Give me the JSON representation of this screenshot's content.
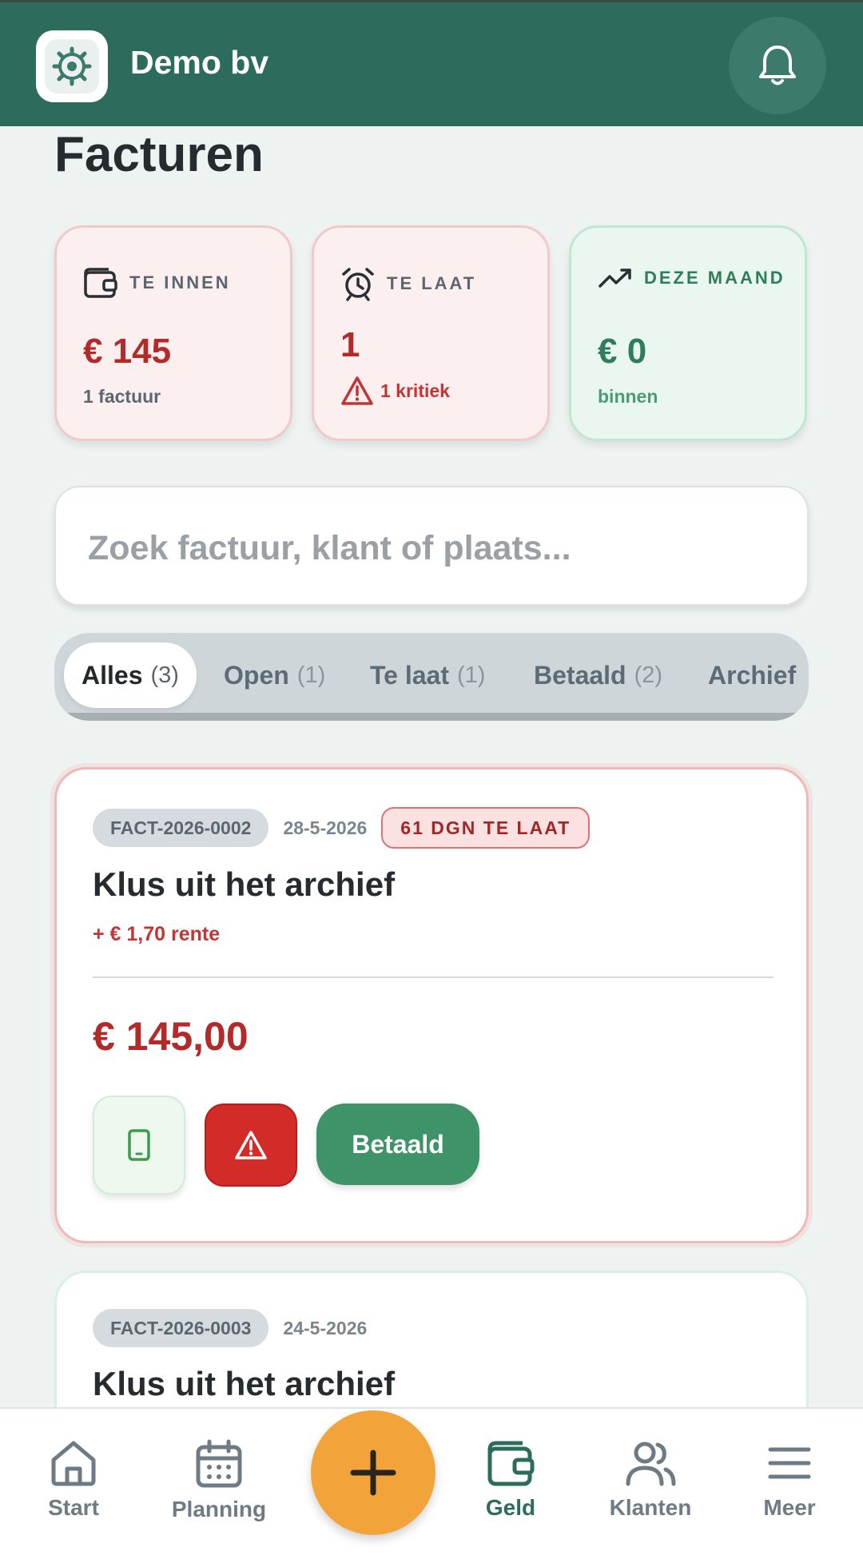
{
  "header": {
    "company": "Demo bv"
  },
  "page": {
    "title": "Facturen"
  },
  "stats": [
    {
      "label": "TE INNEN",
      "value": "€ 145",
      "sub": "1 factuur"
    },
    {
      "label": "TE LAAT",
      "value": "1",
      "sub": "1 kritiek"
    },
    {
      "label": "DEZE MAAND",
      "value": "€ 0",
      "sub": "binnen"
    }
  ],
  "search": {
    "placeholder": "Zoek factuur, klant of plaats..."
  },
  "tabs": [
    {
      "label": "Alles",
      "count": "(3)"
    },
    {
      "label": "Open",
      "count": "(1)"
    },
    {
      "label": "Te laat",
      "count": "(1)"
    },
    {
      "label": "Betaald",
      "count": "(2)"
    },
    {
      "label": "Archief",
      "count": ""
    }
  ],
  "invoices": [
    {
      "number": "FACT-2026-0002",
      "date": "28-5-2026",
      "badge": "61 DGN TE LAAT",
      "title": "Klus uit het archief",
      "interest": "+ € 1,70 rente",
      "amount": "€ 145,00",
      "paid_button": "Betaald"
    },
    {
      "number": "FACT-2026-0003",
      "date": "24-5-2026",
      "title": "Klus uit het archief"
    }
  ],
  "nav": [
    {
      "label": "Start",
      "icon": "home-icon"
    },
    {
      "label": "Planning",
      "icon": "calendar-icon"
    },
    {
      "label": "Geld",
      "icon": "wallet-icon",
      "active": true
    },
    {
      "label": "Klanten",
      "icon": "users-icon"
    },
    {
      "label": "Meer",
      "icon": "menu-icon"
    }
  ],
  "colors": {
    "brand": "#2d6b5c",
    "accent": "#f2a43a",
    "danger": "#d32b27",
    "success": "#3f9369"
  }
}
